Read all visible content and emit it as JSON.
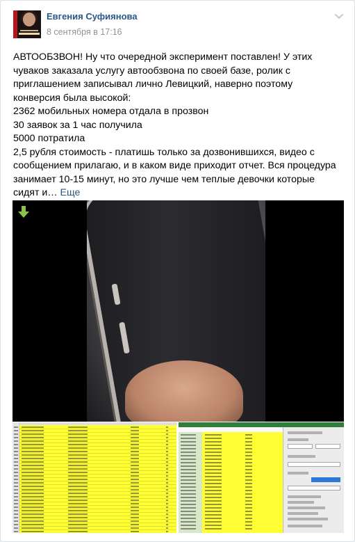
{
  "post": {
    "author": "Евгения Суфиянова",
    "date": "8 сентября в 17:16",
    "text_lines": [
      "АВТООБЗВОН! Ну что очередной эксперимент поставлен! У этих",
      "чуваков заказала услугу автообзвона по своей базе, ролик с",
      "приглашением записывал лично Левицкий, наверно поэтому",
      "конверсия была высокой:",
      "2362 мобильных номера отдала в прозвон",
      "30 заявок за 1 час получила",
      "5000 потратила",
      "2,5 рубля стоимость - платишь только за дозвонившихся, видео с",
      "сообщением прилагаю, и в каком виде приходит отчет. Вся процедура",
      "занимает 10-15 минут, но это лучше чем теплые девочки которые"
    ],
    "last_line_prefix": "сидят и… ",
    "more_link": "Еще"
  },
  "icons": {
    "more_menu": "chevron-down-icon",
    "download": "arrow-down-icon"
  },
  "colors": {
    "link": "#2a5885",
    "date": "#939393",
    "download_arrow": "#8bc34a",
    "highlight": "#ffff33"
  }
}
